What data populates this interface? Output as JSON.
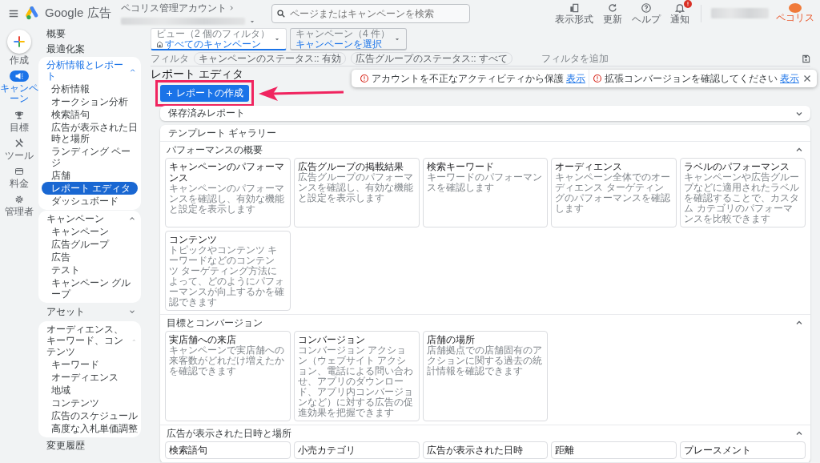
{
  "top_bar": {
    "product": "Google 広告",
    "account_label": "ペコリス管理アカウント",
    "search": {
      "placeholder": "ページまたはキャンペーンを検索"
    },
    "actions": [
      {
        "kind": "appearance",
        "label": "表示形式",
        "badge": false
      },
      {
        "kind": "refresh",
        "label": "更新",
        "badge": false
      },
      {
        "kind": "help",
        "label": "ヘルプ",
        "badge": false
      },
      {
        "kind": "bell",
        "label": "通知",
        "badge": true
      }
    ],
    "avatar_text": "ペコリス"
  },
  "alerts": [
    {
      "text": "アカウントを不正なアクティビティから保護",
      "link": "表示"
    },
    {
      "text": "拡張コンバージョンを確認してください",
      "link": "表示"
    }
  ],
  "rail": [
    {
      "kind": "create",
      "label": "作成",
      "selected": false
    },
    {
      "kind": "campaign",
      "label": "キャンペーン",
      "selected": true
    },
    {
      "kind": "goal",
      "label": "目標",
      "selected": false
    },
    {
      "kind": "tools",
      "label": "ツール",
      "selected": false
    },
    {
      "kind": "billing",
      "label": "料金",
      "selected": false
    },
    {
      "kind": "admin",
      "label": "管理者",
      "selected": false
    }
  ],
  "nav": [
    {
      "kind": "link",
      "label": "概要"
    },
    {
      "kind": "link",
      "label": "最適化案"
    },
    {
      "kind": "section",
      "label": "分析情報とレポート",
      "expanded": true,
      "highlighted": true,
      "children": [
        {
          "label": "分析情報",
          "selected": false
        },
        {
          "label": "オークション分析",
          "selected": false
        },
        {
          "label": "検索語句",
          "selected": false
        },
        {
          "label": "広告が表示された日時と場所",
          "selected": false
        },
        {
          "label": "ランディング ページ",
          "selected": false
        },
        {
          "label": "店舗",
          "selected": false
        },
        {
          "label": "レポート エディタ",
          "selected": true
        },
        {
          "label": "ダッシュボード",
          "selected": false
        }
      ]
    },
    {
      "kind": "section",
      "label": "キャンペーン",
      "expanded": true,
      "highlighted": false,
      "children": [
        {
          "label": "キャンペーン",
          "selected": false
        },
        {
          "label": "広告グループ",
          "selected": false
        },
        {
          "label": "広告",
          "selected": false
        },
        {
          "label": "テスト",
          "selected": false
        },
        {
          "label": "キャンペーン グループ",
          "selected": false
        }
      ]
    },
    {
      "kind": "section",
      "label": "アセット",
      "expanded": false,
      "highlighted": false
    },
    {
      "kind": "section",
      "label": "オーディエンス、キーワード、コンテンツ",
      "expanded": true,
      "highlighted": false,
      "children": [
        {
          "label": "キーワード",
          "selected": false
        },
        {
          "label": "オーディエンス",
          "selected": false
        },
        {
          "label": "地域",
          "selected": false
        },
        {
          "label": "コンテンツ",
          "selected": false
        },
        {
          "label": "広告のスケジュール",
          "selected": false
        },
        {
          "label": "高度な入札単価調整",
          "selected": false
        }
      ]
    },
    {
      "kind": "link",
      "label": "変更履歴"
    }
  ],
  "selectors": [
    {
      "kind": "view",
      "label": "ビュー（2 個のフィルタ）",
      "value": "すべてのキャンペーン",
      "selected": true
    },
    {
      "kind": "campaign",
      "label": "キャンペーン（4 件）",
      "value": "キャンペーンを選択",
      "selected": false
    }
  ],
  "filters": {
    "label": "フィルタ",
    "chips": [
      "キャンペーンのステータス:: 有効",
      "広告グループのステータス:: すべて"
    ],
    "add": "フィルタを追加"
  },
  "page_title": "レポート エディタ",
  "create_button": "レポートの作成",
  "saved_reports": {
    "title": "保存済みレポート",
    "expanded": false
  },
  "gallery": {
    "title": "テンプレート ギャラリー",
    "sections": [
      {
        "title": "パフォーマンスの概要",
        "expanded": true,
        "cards": [
          {
            "title": "キャンペーンのパフォーマンス",
            "description": "キャンペーンのパフォーマンスを確認し、有効な機能と設定を表示します"
          },
          {
            "title": "広告グループの掲載結果",
            "description": "広告グループのパフォーマンスを確認し、有効な機能と設定を表示します"
          },
          {
            "title": "検索キーワード",
            "description": "キーワードのパフォーマンスを確認します"
          },
          {
            "title": "オーディエンス",
            "description": "キャンペーン全体でのオーディエンス ターゲティングのパフォーマンスを確認します"
          },
          {
            "title": "ラベルのパフォーマンス",
            "description": "キャンペーンや広告グループなどに適用されたラベルを確認することで、カスタム カテゴリのパフォーマンスを比較できます"
          },
          {
            "title": "コンテンツ",
            "description": "トピックやコンテンツ キーワードなどのコンテンツ ターゲティング方法によって、どのようにパフォーマンスが向上するかを確認できます"
          }
        ]
      },
      {
        "title": "目標とコンバージョン",
        "expanded": true,
        "cards": [
          {
            "title": "実店舗への来店",
            "description": "キャンペーンで実店舗への来客数がどれだけ増えたかを確認できます"
          },
          {
            "title": "コンバージョン",
            "description": "コンバージョン アクション（ウェブサイト アクション、電話による問い合わせ、アプリのダウンロード、アプリ内コンバージョンなど）に対する広告の促進効果を把握できます"
          },
          {
            "title": "店舗の場所",
            "description": "店舗拠点での店舗固有のアクションに関する過去の統計情報を確認できます"
          }
        ]
      },
      {
        "title": "広告が表示された日時と場所",
        "expanded": true,
        "cards": [
          {
            "title": "検索語句"
          },
          {
            "title": "小売カテゴリ"
          },
          {
            "title": "広告が表示された日時"
          },
          {
            "title": "距離"
          },
          {
            "title": "プレースメント"
          }
        ]
      }
    ]
  }
}
